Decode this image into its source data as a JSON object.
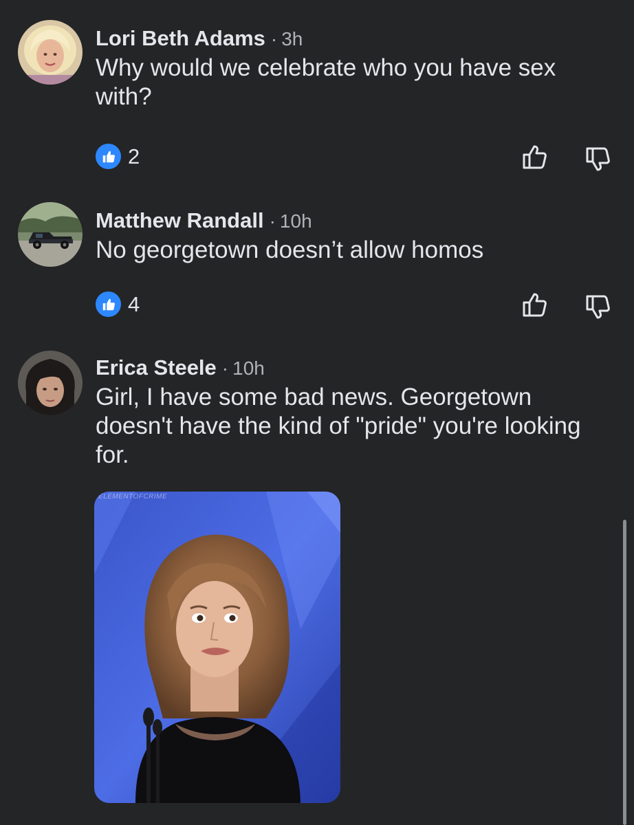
{
  "comments": [
    {
      "author": "Lori Beth Adams",
      "separator": "·",
      "time": "3h",
      "text": "Why would we celebrate who you have sex with?",
      "likes": "2",
      "avatar": "woman-blonde-avatar"
    },
    {
      "author": "Matthew Randall",
      "separator": "·",
      "time": "10h",
      "text": "No georgetown doesn’t allow homos",
      "likes": "4",
      "avatar": "black-pickup-truck-avatar"
    },
    {
      "author": "Erica Steele",
      "separator": "·",
      "time": "10h",
      "text": "Girl, I have some bad news. Georgetown doesn't have the kind of \"pride\" you're looking for.",
      "avatar": "dark-haired-person-avatar",
      "gif": {
        "watermark": "ELEMENTOFCRIME",
        "subject": "woman-grimacing-at-podium"
      }
    }
  ],
  "icons": {
    "like_reaction": "thumbs-up-icon",
    "upvote": "upvote-icon",
    "downvote": "downvote-icon"
  },
  "colors": {
    "background": "#242526",
    "like_blue": "#2d88ff",
    "primary_text": "#e4e6eb",
    "secondary_text": "#b0b3b8"
  }
}
